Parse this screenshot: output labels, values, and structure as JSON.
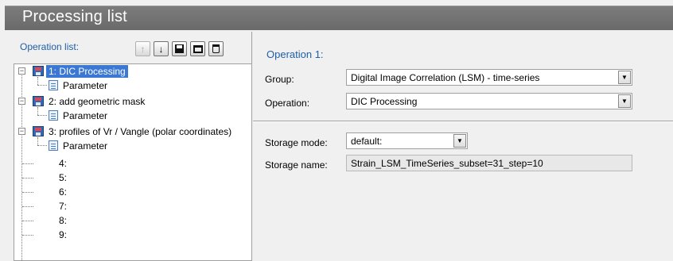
{
  "window": {
    "title": "Processing list"
  },
  "left": {
    "list_label": "Operation list:",
    "toolbar": [
      {
        "name": "move-up-icon",
        "glyph": "🡡",
        "disabled": true
      },
      {
        "name": "move-down-icon",
        "glyph": "🡣",
        "disabled": false
      },
      {
        "name": "save-icon",
        "glyph": "▪",
        "disabled": false
      },
      {
        "name": "load-icon",
        "glyph": "▭",
        "disabled": false
      },
      {
        "name": "delete-icon",
        "glyph": "🗑",
        "disabled": false
      }
    ],
    "tree": {
      "op1": "1: DIC Processing",
      "op1_param": "Parameter",
      "op2": "2: add geometric mask",
      "op2_param": "Parameter",
      "op3": "3: profiles of Vr / Vangle (polar coordinates)",
      "op3_param": "Parameter",
      "slot4": "4:",
      "slot5": "5:",
      "slot6": "6:",
      "slot7": "7:",
      "slot8": "8:",
      "slot9": "9:"
    }
  },
  "right": {
    "header": "Operation 1:",
    "group_label": "Group:",
    "group_value": "Digital Image Correlation (LSM) - time-series",
    "operation_label": "Operation:",
    "operation_value": "DIC Processing",
    "storage_mode_label": "Storage mode:",
    "storage_mode_value": "default:",
    "storage_name_label": "Storage name:",
    "storage_name_value": "Strain_LSM_TimeSeries_subset=31_step=10"
  },
  "colors": {
    "accent": "#1f5fa8",
    "selection": "#3a78d4",
    "titlebar": "#727272"
  }
}
